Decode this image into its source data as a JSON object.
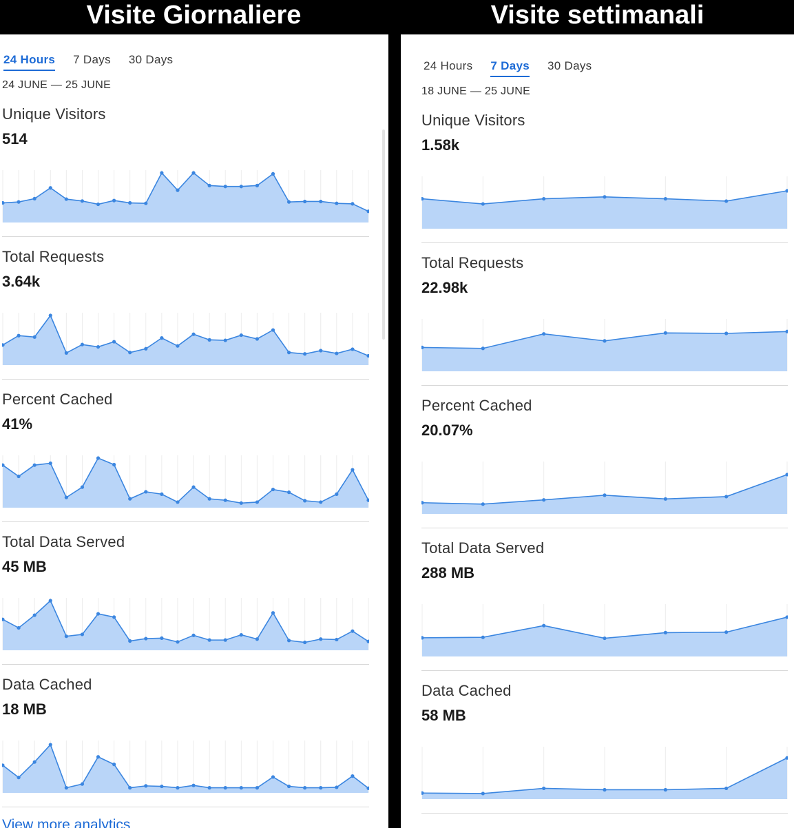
{
  "panels": [
    {
      "id": "left",
      "header": "Visite Giornaliere",
      "tabs": [
        {
          "label": "24 Hours",
          "active": true
        },
        {
          "label": "7 Days",
          "active": false
        },
        {
          "label": "30 Days",
          "active": false
        }
      ],
      "date_range": "24 JUNE — 25 JUNE",
      "metrics": [
        {
          "label": "Unique Visitors",
          "value": "514"
        },
        {
          "label": "Total Requests",
          "value": "3.64k"
        },
        {
          "label": "Percent Cached",
          "value": "41%"
        },
        {
          "label": "Total Data Served",
          "value": "45 MB"
        },
        {
          "label": "Data Cached",
          "value": "18 MB"
        }
      ],
      "more_link": "View more analytics"
    },
    {
      "id": "right",
      "header": "Visite settimanali",
      "tabs": [
        {
          "label": "24 Hours",
          "active": false
        },
        {
          "label": "7 Days",
          "active": true
        },
        {
          "label": "30 Days",
          "active": false
        }
      ],
      "date_range": "18 JUNE — 25 JUNE",
      "metrics": [
        {
          "label": "Unique Visitors",
          "value": "1.58k"
        },
        {
          "label": "Total Requests",
          "value": "22.98k"
        },
        {
          "label": "Percent Cached",
          "value": "20.07%"
        },
        {
          "label": "Total Data Served",
          "value": "288 MB"
        },
        {
          "label": "Data Cached",
          "value": "58 MB"
        }
      ]
    }
  ],
  "colors": {
    "accent": "#1d6bd6",
    "line": "#3b86e0",
    "fill": "#b9d5f8",
    "gridline": "#ececec"
  },
  "chart_data": [
    {
      "type": "area",
      "panel": "left",
      "metric": "Unique Visitors",
      "values": [
        0.36,
        0.38,
        0.45,
        0.68,
        0.44,
        0.4,
        0.33,
        0.41,
        0.36,
        0.35,
        1.0,
        0.63,
        1.0,
        0.73,
        0.71,
        0.71,
        0.73,
        0.98,
        0.38,
        0.39,
        0.39,
        0.35,
        0.34,
        0.18
      ]
    },
    {
      "type": "area",
      "panel": "left",
      "metric": "Total Requests",
      "values": [
        0.37,
        0.57,
        0.54,
        1.0,
        0.2,
        0.38,
        0.33,
        0.44,
        0.21,
        0.29,
        0.52,
        0.35,
        0.6,
        0.48,
        0.47,
        0.58,
        0.5,
        0.69,
        0.21,
        0.18,
        0.25,
        0.19,
        0.28,
        0.14
      ]
    },
    {
      "type": "area",
      "panel": "left",
      "metric": "Percent Cached",
      "values": [
        0.85,
        0.61,
        0.85,
        0.89,
        0.16,
        0.38,
        1.0,
        0.86,
        0.13,
        0.28,
        0.23,
        0.06,
        0.38,
        0.13,
        0.1,
        0.04,
        0.06,
        0.33,
        0.27,
        0.09,
        0.06,
        0.23,
        0.75,
        0.1
      ]
    },
    {
      "type": "area",
      "panel": "left",
      "metric": "Total Data Served",
      "values": [
        0.6,
        0.42,
        0.69,
        1.0,
        0.24,
        0.28,
        0.72,
        0.65,
        0.14,
        0.19,
        0.2,
        0.12,
        0.26,
        0.16,
        0.16,
        0.27,
        0.18,
        0.74,
        0.15,
        0.11,
        0.18,
        0.17,
        0.35,
        0.13
      ]
    },
    {
      "type": "area",
      "panel": "left",
      "metric": "Data Cached",
      "values": [
        0.53,
        0.27,
        0.6,
        0.97,
        0.05,
        0.13,
        0.71,
        0.55,
        0.05,
        0.09,
        0.08,
        0.05,
        0.1,
        0.05,
        0.05,
        0.05,
        0.05,
        0.28,
        0.08,
        0.05,
        0.05,
        0.06,
        0.3,
        0.04
      ]
    },
    {
      "type": "area",
      "panel": "right",
      "metric": "Unique Visitors",
      "values": [
        0.58,
        0.47,
        0.58,
        0.62,
        0.58,
        0.53,
        0.75
      ]
    },
    {
      "type": "area",
      "panel": "right",
      "metric": "Total Requests",
      "values": [
        0.45,
        0.43,
        0.74,
        0.59,
        0.76,
        0.75,
        0.79
      ]
    },
    {
      "type": "area",
      "panel": "right",
      "metric": "Percent Cached",
      "values": [
        0.18,
        0.15,
        0.24,
        0.34,
        0.26,
        0.31,
        0.78
      ]
    },
    {
      "type": "area",
      "panel": "right",
      "metric": "Total Data Served",
      "values": [
        0.34,
        0.35,
        0.6,
        0.33,
        0.45,
        0.46,
        0.78
      ]
    },
    {
      "type": "area",
      "panel": "right",
      "metric": "Data Cached",
      "values": [
        0.07,
        0.06,
        0.17,
        0.14,
        0.14,
        0.17,
        0.82
      ]
    }
  ]
}
